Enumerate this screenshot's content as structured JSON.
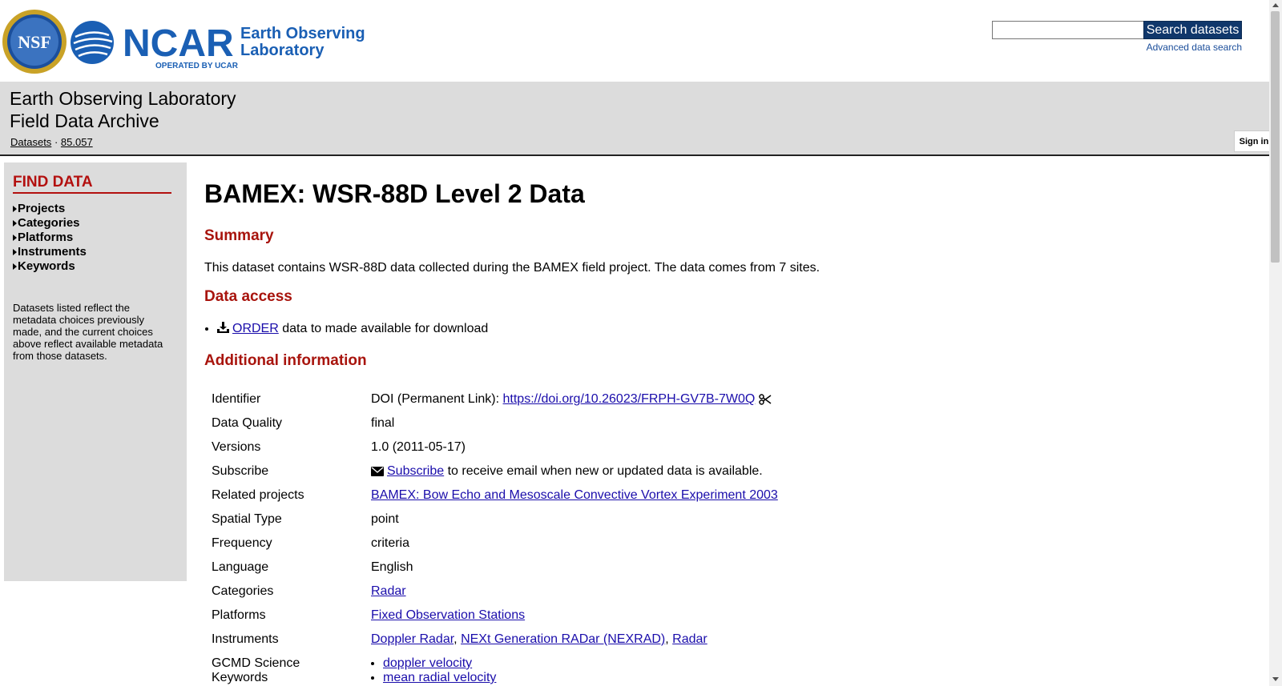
{
  "header": {
    "ncar": {
      "wordmark": "NCAR",
      "lab_line1": "Earth Observing",
      "lab_line2": "Laboratory",
      "operated_by": "OPERATED BY UCAR"
    },
    "nsf_logo_text": "NSF",
    "search": {
      "placeholder": "",
      "button_label": "Search datasets",
      "advanced_link": "Advanced data search"
    }
  },
  "titlebar": {
    "title_line1": "Earth Observing Laboratory",
    "title_line2": "Field Data Archive",
    "breadcrumb": {
      "item1": "Datasets",
      "separator": "·",
      "item2": "85.057"
    },
    "sign_in": "Sign in"
  },
  "sidebar": {
    "heading": "FIND DATA",
    "items": [
      "Projects",
      "Categories",
      "Platforms",
      "Instruments",
      "Keywords"
    ],
    "note": "Datasets listed reflect the metadata choices previously made, and the current choices above reflect available metadata from those datasets."
  },
  "main": {
    "title": "BAMEX: WSR-88D Level 2 Data",
    "summary_heading": "Summary",
    "summary_text": "This dataset contains WSR-88D data collected during the BAMEX field project. The data comes from 7 sites.",
    "access_heading": "Data access",
    "access_link": "ORDER",
    "access_text": " data to made available for download",
    "additional_heading": "Additional information",
    "info": {
      "identifier_label": "Identifier",
      "identifier_prefix": "DOI (Permanent Link): ",
      "identifier_link": "https://doi.org/10.26023/FRPH-GV7B-7W0Q",
      "quality_label": "Data Quality",
      "quality_value": "final",
      "versions_label": "Versions",
      "versions_value": "1.0 (2011-05-17)",
      "subscribe_label": "Subscribe",
      "subscribe_link": "Subscribe",
      "subscribe_text": " to receive email when new or updated data is available.",
      "projects_label": "Related projects",
      "projects_link": "BAMEX: Bow Echo and Mesoscale Convective Vortex Experiment 2003",
      "spatial_label": "Spatial Type",
      "spatial_value": "point",
      "frequency_label": "Frequency",
      "frequency_value": "criteria",
      "language_label": "Language",
      "language_value": "English",
      "categories_label": "Categories",
      "categories_link": "Radar",
      "platforms_label": "Platforms",
      "platforms_link": "Fixed Observation Stations",
      "instruments_label": "Instruments",
      "instruments_links": [
        "Doppler Radar",
        "NEXt Generation RADar (NEXRAD)",
        "Radar"
      ],
      "instruments_sep": ", ",
      "gcmd_label": "GCMD Science Keywords",
      "gcmd_links": [
        "doppler velocity",
        "mean radial velocity"
      ]
    }
  },
  "colors": {
    "accent_red": "#a8140d",
    "search_button": "#10376b",
    "ncar_blue": "#1a5fb4",
    "panel_gray": "#dcdcdc"
  }
}
